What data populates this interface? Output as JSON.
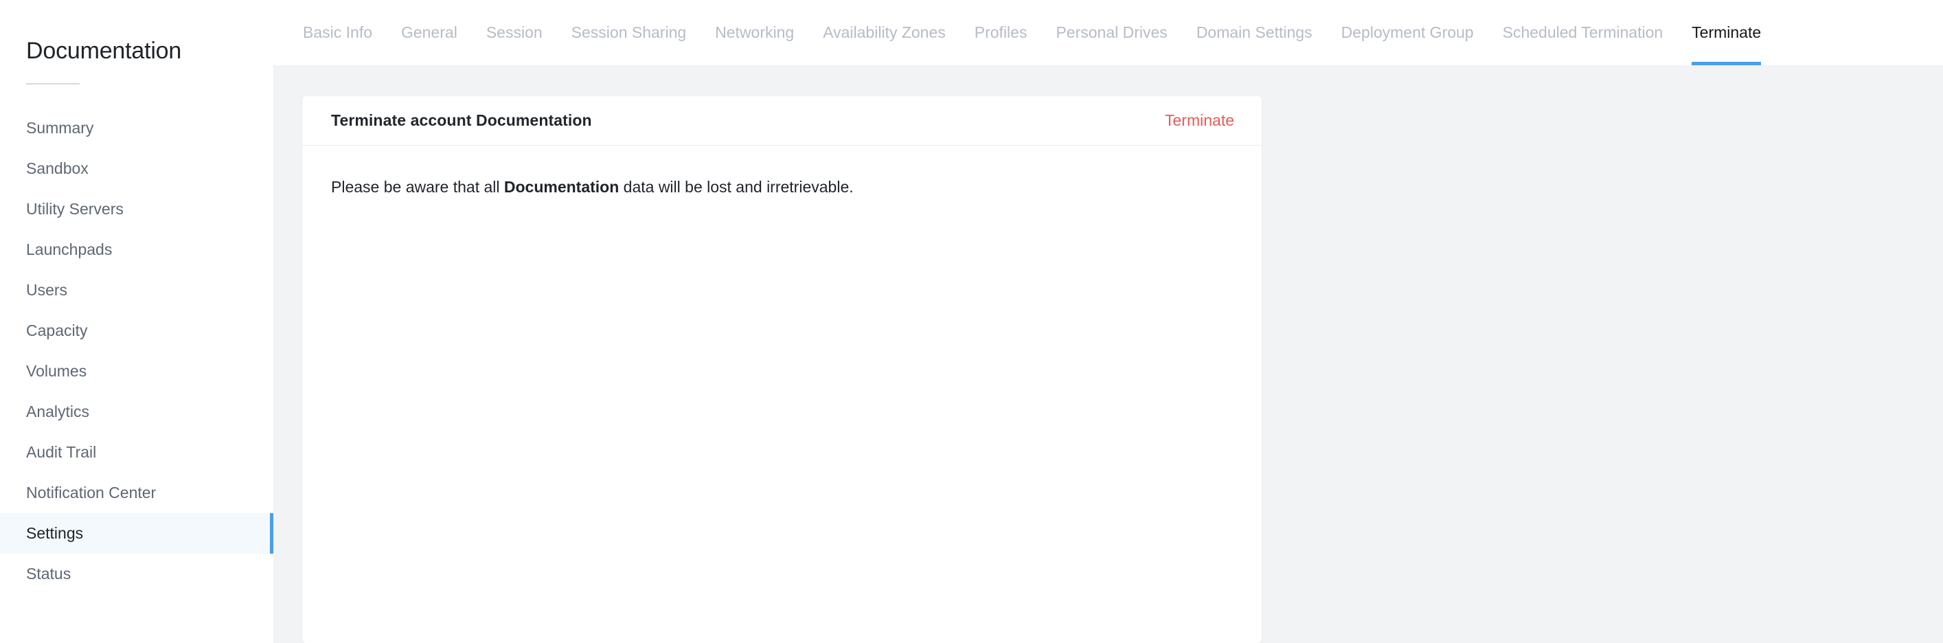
{
  "sidebar": {
    "title": "Documentation",
    "items": [
      {
        "label": "Summary",
        "active": false
      },
      {
        "label": "Sandbox",
        "active": false
      },
      {
        "label": "Utility Servers",
        "active": false
      },
      {
        "label": "Launchpads",
        "active": false
      },
      {
        "label": "Users",
        "active": false
      },
      {
        "label": "Capacity",
        "active": false
      },
      {
        "label": "Volumes",
        "active": false
      },
      {
        "label": "Analytics",
        "active": false
      },
      {
        "label": "Audit Trail",
        "active": false
      },
      {
        "label": "Notification Center",
        "active": false
      },
      {
        "label": "Settings",
        "active": true
      },
      {
        "label": "Status",
        "active": false
      }
    ]
  },
  "tabs": [
    {
      "label": "Basic Info",
      "active": false
    },
    {
      "label": "General",
      "active": false
    },
    {
      "label": "Session",
      "active": false
    },
    {
      "label": "Session Sharing",
      "active": false
    },
    {
      "label": "Networking",
      "active": false
    },
    {
      "label": "Availability Zones",
      "active": false
    },
    {
      "label": "Profiles",
      "active": false
    },
    {
      "label": "Personal Drives",
      "active": false
    },
    {
      "label": "Domain Settings",
      "active": false
    },
    {
      "label": "Deployment Group",
      "active": false
    },
    {
      "label": "Scheduled Termination",
      "active": false
    },
    {
      "label": "Terminate",
      "active": true
    }
  ],
  "card": {
    "title": "Terminate account Documentation",
    "action_label": "Terminate",
    "message_prefix": "Please be aware that all ",
    "message_emphasis": "Documentation",
    "message_suffix": " data will be lost and irretrievable."
  },
  "colors": {
    "accent_blue": "#4a9fe8",
    "danger_red": "#e35d55",
    "content_background": "#f2f3f5",
    "sidebar_active_background": "#f4f9fe",
    "muted_text": "#b6bcc6",
    "nav_text": "#5d6773"
  }
}
